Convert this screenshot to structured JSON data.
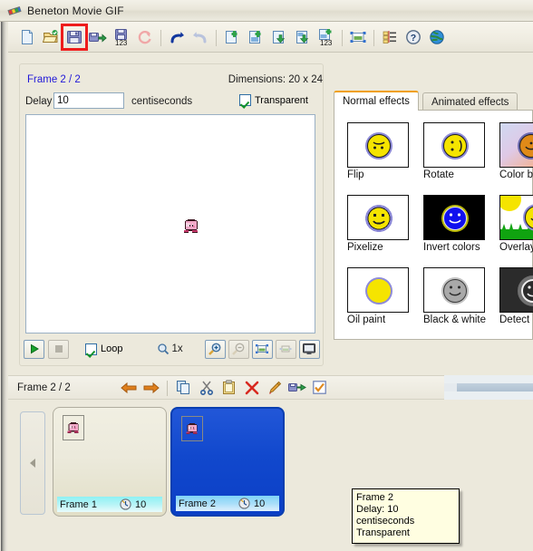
{
  "window": {
    "title": "Beneton Movie GIF",
    "app_icon": "film-strip-icon"
  },
  "toolbar": {
    "buttons": [
      {
        "name": "new-file-button",
        "icon": "new-document-icon",
        "label": "New",
        "highlighted": false
      },
      {
        "name": "open-file-button",
        "icon": "open-folder-icon",
        "label": "Open",
        "highlighted": false
      },
      {
        "name": "save-file-button",
        "icon": "floppy-disk-icon",
        "label": "Save",
        "highlighted": true
      },
      {
        "name": "save-as-button",
        "icon": "floppy-arrow-icon",
        "label": "Save as",
        "highlighted": false
      },
      {
        "name": "save-frames-button",
        "icon": "floppy-123-icon",
        "label": "Save frames",
        "highlighted": false
      },
      {
        "name": "refresh-button",
        "icon": "refresh-circular-icon",
        "label": "Refresh",
        "highlighted": false
      },
      {
        "name": "undo-button",
        "icon": "undo-arrow-icon",
        "label": "Undo",
        "highlighted": false
      },
      {
        "name": "redo-button",
        "icon": "redo-arrow-icon",
        "label": "Redo",
        "highlighted": false
      },
      {
        "name": "insert-blank-frame-button",
        "icon": "page-plus-icon",
        "label": "Insert blank frame",
        "highlighted": false
      },
      {
        "name": "insert-image-frame-button",
        "icon": "image-plus-icon",
        "label": "Insert image",
        "highlighted": false
      },
      {
        "name": "export-frame-button",
        "icon": "page-down-arrow-icon",
        "label": "Export frame",
        "highlighted": false
      },
      {
        "name": "export-image-button",
        "icon": "image-down-arrow-icon",
        "label": "Export image",
        "highlighted": false
      },
      {
        "name": "export-frames-numbered-button",
        "icon": "image-plus-123-icon",
        "label": "Export frames",
        "highlighted": false
      },
      {
        "name": "resize-canvas-button",
        "icon": "resize-selection-icon",
        "label": "Resize",
        "highlighted": false
      },
      {
        "name": "properties-button",
        "icon": "list-properties-icon",
        "label": "Properties",
        "highlighted": false
      },
      {
        "name": "help-button",
        "icon": "question-mark-icon",
        "label": "Help",
        "highlighted": false
      },
      {
        "name": "website-button",
        "icon": "globe-icon",
        "label": "Website",
        "highlighted": false
      }
    ]
  },
  "editor": {
    "frame_label": "Frame 2 / 2",
    "dimensions_label": "Dimensions: 20 x 24",
    "delay_label": "Delay",
    "delay_value": "10",
    "delay_units": "centiseconds",
    "transparent_label": "Transparent",
    "transparent_checked": true
  },
  "player": {
    "play_button": "play-icon",
    "stop_button": "stop-icon",
    "loop_label": "Loop",
    "loop_checked": true,
    "zoom_icon": "magnifier-icon",
    "zoom_level": "1x",
    "zoom_in": "zoom-in-icon",
    "zoom_out": "zoom-out-icon",
    "fit_image": "fit-image-icon",
    "fit_window": "fit-window-icon",
    "full_screen": "monitor-icon"
  },
  "frame_toolbar": {
    "frame_label": "Frame 2 / 2",
    "buttons": [
      {
        "name": "prev-frame-button",
        "icon": "arrow-left-icon"
      },
      {
        "name": "next-frame-button",
        "icon": "arrow-right-icon"
      },
      {
        "name": "copy-frame-button",
        "icon": "copy-icon"
      },
      {
        "name": "cut-frame-button",
        "icon": "scissors-icon"
      },
      {
        "name": "paste-frame-button",
        "icon": "clipboard-icon"
      },
      {
        "name": "delete-frame-button",
        "icon": "red-x-icon"
      },
      {
        "name": "edit-frame-button",
        "icon": "pencil-icon"
      },
      {
        "name": "move-frame-button",
        "icon": "floppy-arrow-green-icon"
      },
      {
        "name": "select-frame-button",
        "icon": "orange-check-icon"
      }
    ]
  },
  "filmstrip": {
    "prev_arrow": "triangle-left-icon",
    "frames": [
      {
        "name": "Frame 1",
        "delay": "10",
        "selected": false,
        "clock_icon": "clock-icon"
      },
      {
        "name": "Frame 2",
        "delay": "10",
        "selected": true,
        "clock_icon": "clock-icon"
      }
    ]
  },
  "tooltip": {
    "line1": "Frame 2",
    "line2": "Delay: 10 centiseconds",
    "line3": "Transparent"
  },
  "effects": {
    "tabs": [
      {
        "label": "Normal effects",
        "active": true
      },
      {
        "label": "Animated effects",
        "active": false
      }
    ],
    "items": [
      {
        "label": "Flip",
        "style": "flip"
      },
      {
        "label": "Rotate",
        "style": "rotate"
      },
      {
        "label": "Color b",
        "style": "colorbalance"
      },
      {
        "label": "Pixelize",
        "style": "pixelize"
      },
      {
        "label": "Invert colors",
        "style": "invert"
      },
      {
        "label": "Overlay",
        "style": "overlay"
      },
      {
        "label": "Oil paint",
        "style": "oilpaint"
      },
      {
        "label": "Black & white",
        "style": "blackwhite"
      },
      {
        "label": "Detect",
        "style": "detectedges"
      }
    ]
  },
  "colors": {
    "window_bg": "#ece9dc",
    "accent_blue": "#2118d8",
    "highlight_red": "#ee1c1c",
    "selection_blue": "#1148cd",
    "tab_accent": "#f0a012",
    "tooltip_bg": "#fffee1"
  }
}
